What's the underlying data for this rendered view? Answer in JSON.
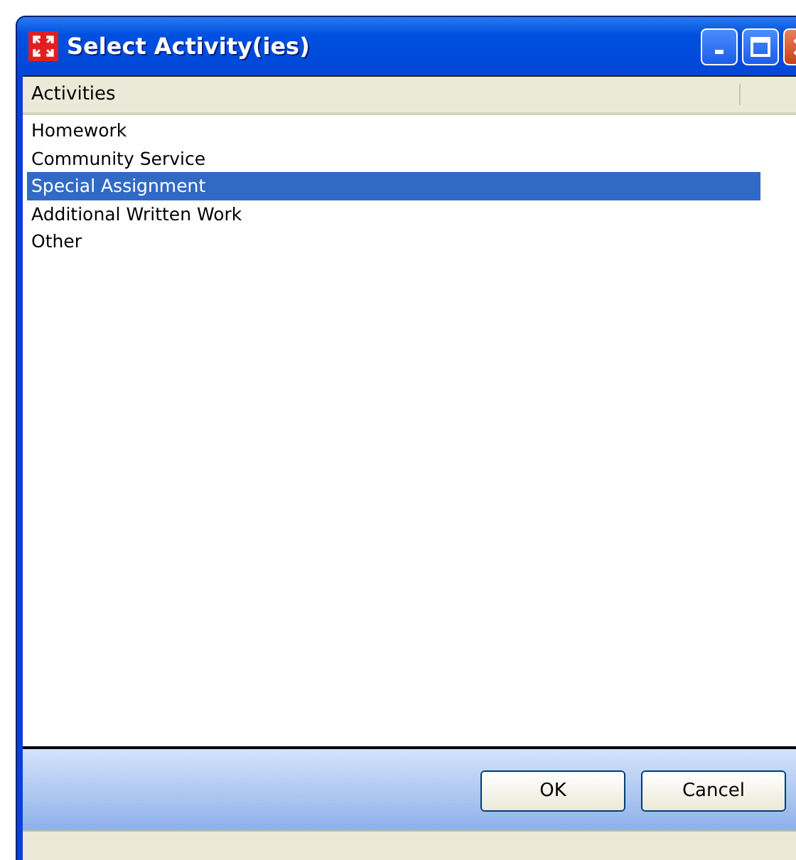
{
  "window": {
    "title": "Select Activity(ies)"
  },
  "table": {
    "columns": [
      "Activities"
    ],
    "rows": [
      {
        "label": "Homework",
        "selected": false
      },
      {
        "label": "Community Service",
        "selected": false
      },
      {
        "label": "Special Assignment",
        "selected": true
      },
      {
        "label": "Additional Written Work",
        "selected": false
      },
      {
        "label": "Other",
        "selected": false
      }
    ]
  },
  "buttons": [
    "OK",
    "Cancel"
  ]
}
